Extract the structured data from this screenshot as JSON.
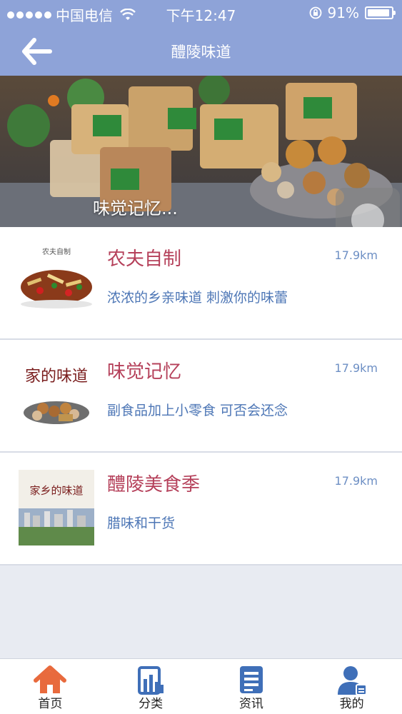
{
  "status_bar": {
    "carrier": "中国电信",
    "time": "下午12:47",
    "battery": "91%"
  },
  "nav": {
    "title": "醴陵味道",
    "back_icon": "arrow-left-icon"
  },
  "banner": {
    "caption": "味觉记忆..."
  },
  "list": [
    {
      "title": "农夫自制",
      "distance": "17.9km",
      "desc": "浓浓的乡亲味道 刺激你的味蕾",
      "thumb_text": "农夫自制"
    },
    {
      "title": "味觉记忆",
      "distance": "17.9km",
      "desc": "副食品加上小零食 可否会还念",
      "thumb_text": "家的味道"
    },
    {
      "title": "醴陵美食季",
      "distance": "17.9km",
      "desc": "腊味和干货",
      "thumb_text": "家乡的味道"
    }
  ],
  "tabbar": [
    {
      "label": "首页",
      "icon": "home-icon",
      "active": true
    },
    {
      "label": "分类",
      "icon": "category-icon",
      "active": false
    },
    {
      "label": "资讯",
      "icon": "news-icon",
      "active": false
    },
    {
      "label": "我的",
      "icon": "user-icon",
      "active": false
    }
  ],
  "colors": {
    "header": "#8ea3d8",
    "title": "#b5405a",
    "desc": "#4e77b6",
    "distance": "#6d8fc4",
    "home_active": "#e86a3d",
    "tab_inactive": "#3f6fb8"
  }
}
